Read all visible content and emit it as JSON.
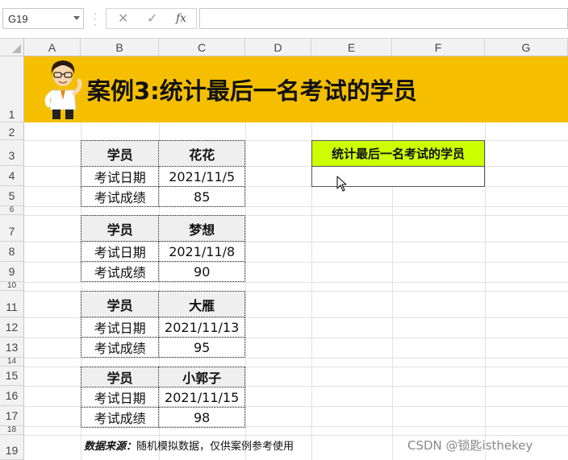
{
  "formula_bar": {
    "name_box": "G19",
    "cancel_icon": "✕",
    "enter_icon": "✓",
    "fx_label": "fx",
    "formula": ""
  },
  "columns": [
    "A",
    "B",
    "C",
    "D",
    "E",
    "F",
    "G"
  ],
  "rows": [
    "1",
    "2",
    "3",
    "4",
    "5",
    "6",
    "7",
    "8",
    "9",
    "10",
    "11",
    "12",
    "13",
    "14",
    "15",
    "16",
    "17",
    "18",
    "19"
  ],
  "banner": {
    "title": "案例3:统计最后一名考试的学员",
    "color": "#f5bf00"
  },
  "tables": [
    {
      "header": [
        "学员",
        "花花"
      ],
      "rows": [
        [
          "考试日期",
          "2021/11/5"
        ],
        [
          "考试成绩",
          "85"
        ]
      ]
    },
    {
      "header": [
        "学员",
        "梦想"
      ],
      "rows": [
        [
          "考试日期",
          "2021/11/8"
        ],
        [
          "考试成绩",
          "90"
        ]
      ]
    },
    {
      "header": [
        "学员",
        "大雁"
      ],
      "rows": [
        [
          "考试日期",
          "2021/11/13"
        ],
        [
          "考试成绩",
          "95"
        ]
      ]
    },
    {
      "header": [
        "学员",
        "小郭子"
      ],
      "rows": [
        [
          "考试日期",
          "2021/11/15"
        ],
        [
          "考试成绩",
          "98"
        ]
      ]
    }
  ],
  "result": {
    "header": "统计最后一名考试的学员",
    "value": "",
    "header_color": "#ccff00"
  },
  "source": {
    "label": "数据来源：",
    "text": "随机模拟数据，仅供案例参考使用"
  },
  "watermark": "CSDN @锁匙isthekey"
}
